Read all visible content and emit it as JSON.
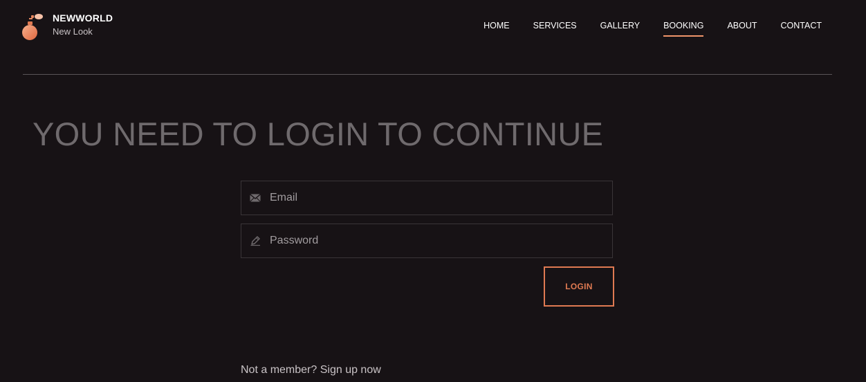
{
  "brand": {
    "name": "NEWWORLD",
    "tagline": "New Look",
    "logo_icon": "perfume-bottle-icon",
    "accent_color": "#f0946a"
  },
  "nav": {
    "items": [
      {
        "label": "HOME",
        "active": false
      },
      {
        "label": "SERVICES",
        "active": false
      },
      {
        "label": "GALLERY",
        "active": false
      },
      {
        "label": "BOOKING",
        "active": true
      },
      {
        "label": "ABOUT",
        "active": false
      },
      {
        "label": "CONTACT",
        "active": false
      }
    ]
  },
  "main": {
    "headline": "YOU NEED TO LOGIN TO CONTINUE"
  },
  "form": {
    "email": {
      "placeholder": "Email",
      "value": "",
      "icon": "envelope-icon"
    },
    "password": {
      "placeholder": "Password",
      "value": "",
      "icon": "pencil-icon"
    },
    "login_label": "LOGIN"
  },
  "signup": {
    "prompt": "Not a member?",
    "link_label": "Sign up now"
  },
  "colors": {
    "background": "#171215",
    "button_accent": "#e07a52",
    "headline": "#6f6a6d"
  }
}
